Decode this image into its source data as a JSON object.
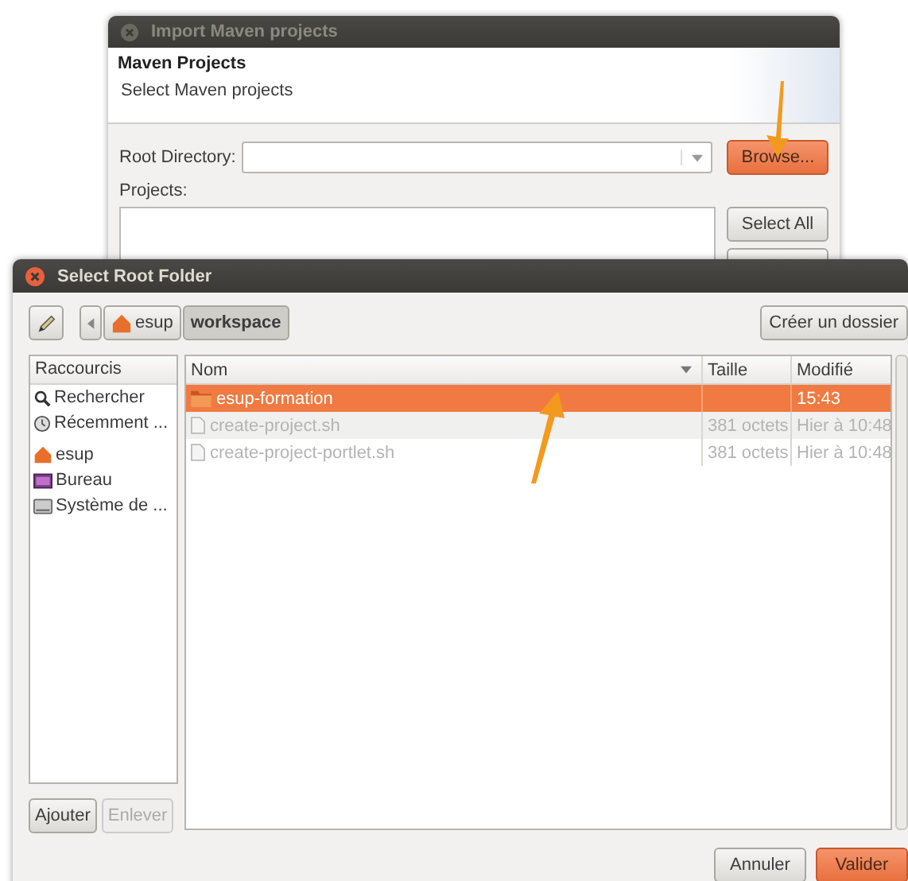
{
  "back_window": {
    "title": "Import Maven projects",
    "header_title": "Maven Projects",
    "header_subtitle": "Select Maven projects",
    "root_label": "Root Directory:",
    "browse_button": "Browse...",
    "projects_label": "Projects:",
    "buttons": [
      "Select All"
    ]
  },
  "dialog": {
    "title": "Select Root Folder",
    "path": [
      {
        "label": "esup",
        "kind": "home",
        "selected": false
      },
      {
        "label": "workspace",
        "kind": "folder",
        "selected": true
      }
    ],
    "create_folder_button": "Créer un dossier",
    "shortcuts_header": "Raccourcis",
    "shortcut_groups": [
      [
        {
          "label": "Rechercher",
          "kind": "search"
        },
        {
          "label": "Récemment ...",
          "kind": "recent"
        }
      ],
      [
        {
          "label": "esup",
          "kind": "home"
        },
        {
          "label": "Bureau",
          "kind": "desktop"
        },
        {
          "label": "Système de ...",
          "kind": "drive"
        }
      ]
    ],
    "shortcut_buttons": [
      {
        "label": "Ajouter",
        "disabled": false
      },
      {
        "label": "Enlever",
        "disabled": true
      }
    ],
    "columns": [
      "Nom",
      "Taille",
      "Modifié"
    ],
    "files": [
      {
        "name": "esup-formation",
        "kind": "folder",
        "modified": "15:43",
        "selected": true,
        "disabled": false
      },
      {
        "name": "create-project.sh",
        "kind": "file",
        "size": "381 octets",
        "modified": "Hier à 10:48",
        "selected": false,
        "disabled": true
      },
      {
        "name": "create-project-portlet.sh",
        "kind": "file",
        "size": "381 octets",
        "modified": "Hier à 10:48",
        "selected": false,
        "disabled": true
      }
    ],
    "buttons": [
      {
        "label": "Annuler",
        "kind": "secondary"
      },
      {
        "label": "Valider",
        "kind": "primary"
      }
    ]
  }
}
